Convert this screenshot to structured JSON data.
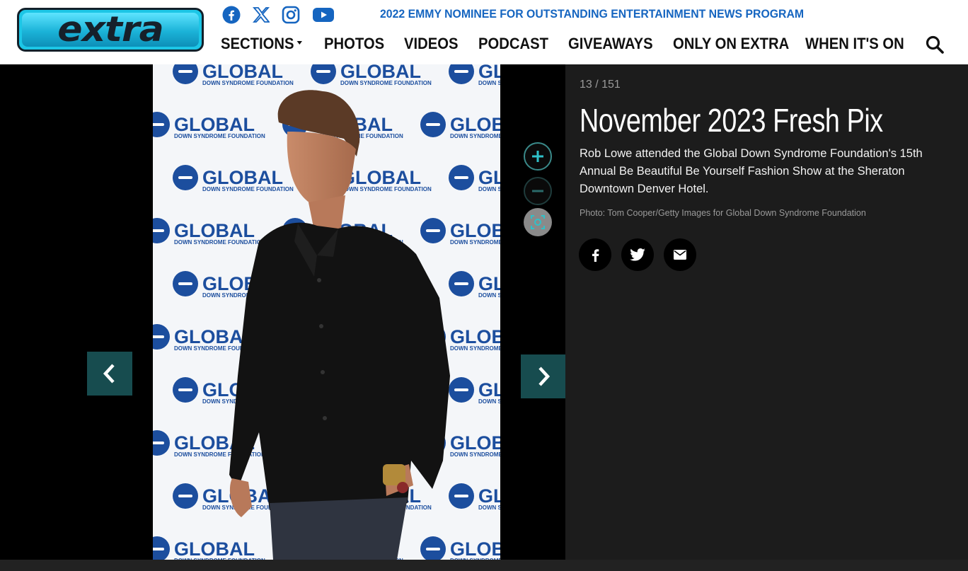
{
  "header": {
    "logo_text": "extra",
    "tagline": "2022 EMMY NOMINEE FOR OUTSTANDING ENTERTAINMENT NEWS PROGRAM",
    "social": [
      "facebook-icon",
      "x-icon",
      "instagram-icon",
      "youtube-icon"
    ],
    "nav": {
      "sections": "SECTIONS",
      "photos": "PHOTOS",
      "videos": "VIDEOS",
      "podcast": "PODCAST",
      "giveaways": "GIVEAWAYS",
      "only_on_extra": "ONLY ON EXTRA",
      "when_its_on": "WHEN IT'S ON"
    }
  },
  "gallery": {
    "counter": "13 / 151",
    "title": "November 2023 Fresh Pix",
    "caption": "Rob Lowe attended the Global Down Syndrome Foundation's 15th Annual Be Beautiful Be Yourself Fashion Show at the Sheraton Downtown Denver Hotel.",
    "credit": "Photo: Tom Cooper/Getty Images for Global Down Syndrome Foundation",
    "share": [
      "facebook-icon",
      "twitter-icon",
      "email-icon"
    ]
  },
  "backdrop": {
    "word": "GLOBAL",
    "sub": "DOWN SYNDROME FOUNDATION"
  },
  "colors": {
    "accent_teal": "#174c4f",
    "tagline_blue": "#1565c0",
    "panel_bg": "#1c1c1c"
  }
}
